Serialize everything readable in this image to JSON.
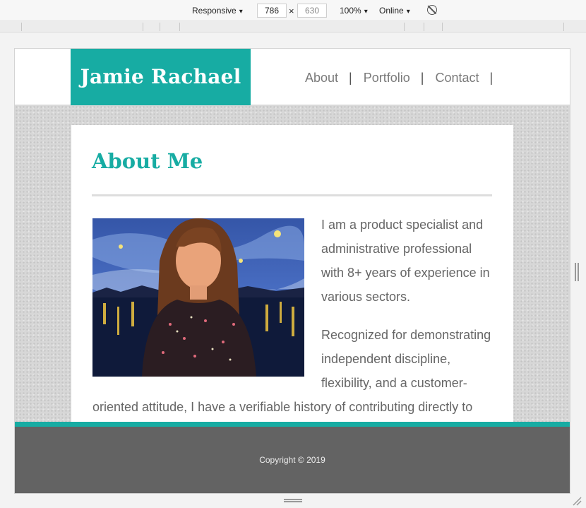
{
  "devtools": {
    "device": "Responsive",
    "width": "786",
    "height_placeholder": "630",
    "times": "×",
    "zoom": "100%",
    "network": "Online",
    "caret": "▾",
    "rotate_icon": "rotate-icon"
  },
  "site": {
    "logo": "Jamie Rachael",
    "nav": [
      {
        "label": "About",
        "sep": "|"
      },
      {
        "label": "Portfolio",
        "sep": "|"
      },
      {
        "label": "Contact",
        "sep": "|"
      }
    ],
    "about": {
      "heading": "About Me",
      "paragraphs": [
        "I am a product specialist and administrative professional with 8+ years of experience in various sectors.",
        "Recognized for demonstrating independent discipline, flexibility, and a customer-",
        "oriented attitude, I have a verifiable history of contributing directly to"
      ]
    },
    "footer": {
      "copyright": "Copyright © 2019"
    },
    "colors": {
      "accent": "#17aca3",
      "footer_bg": "#636363",
      "text": "#666666"
    }
  }
}
